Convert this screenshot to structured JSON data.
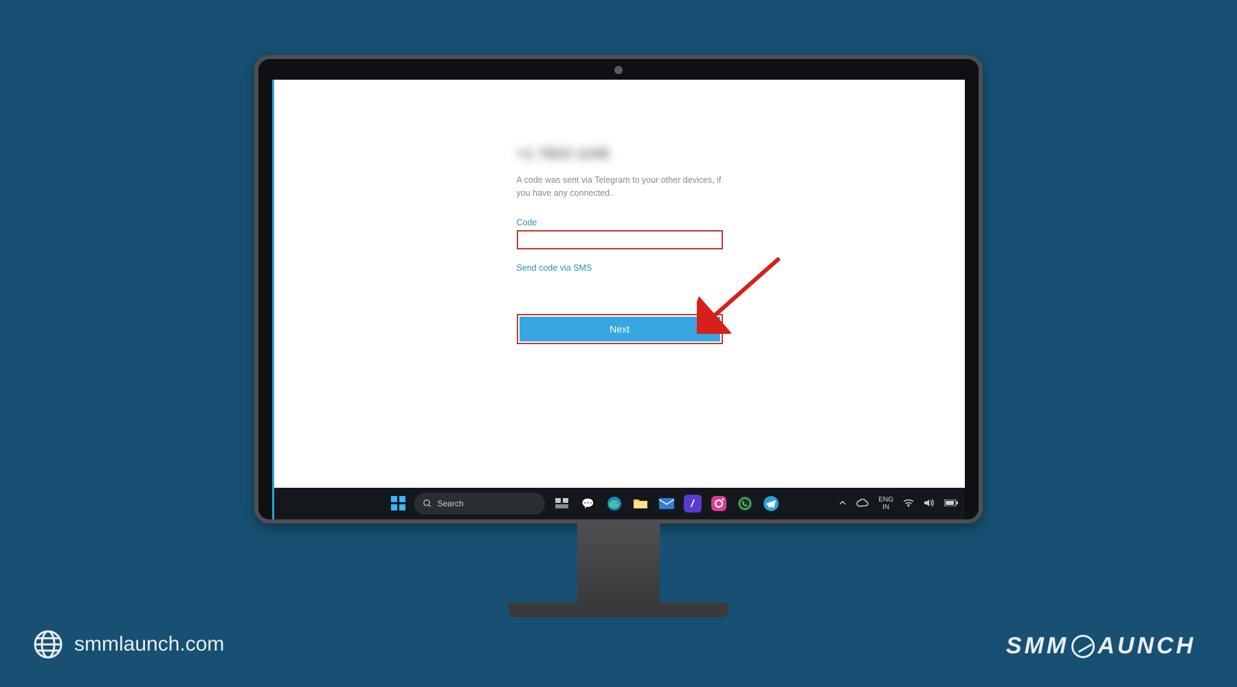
{
  "app": {
    "blurred_heading": "+1 7823 1245",
    "description": "A code was sent via Telegram to your other devices, if you have any connected.",
    "code_label": "Code",
    "code_value": "",
    "sms_link": "Send code via SMS",
    "next_label": "Next"
  },
  "taskbar": {
    "search_placeholder": "Search",
    "lang_top": "ENG",
    "lang_bottom": "IN",
    "icons": [
      "start",
      "search",
      "task-view",
      "chat",
      "edge",
      "explorer",
      "mail",
      "app1",
      "instagram",
      "whatsapp",
      "telegram"
    ]
  },
  "watermark": {
    "left": "smmlaunch.com",
    "right_a": "SMM",
    "right_b": "AUNCH"
  }
}
